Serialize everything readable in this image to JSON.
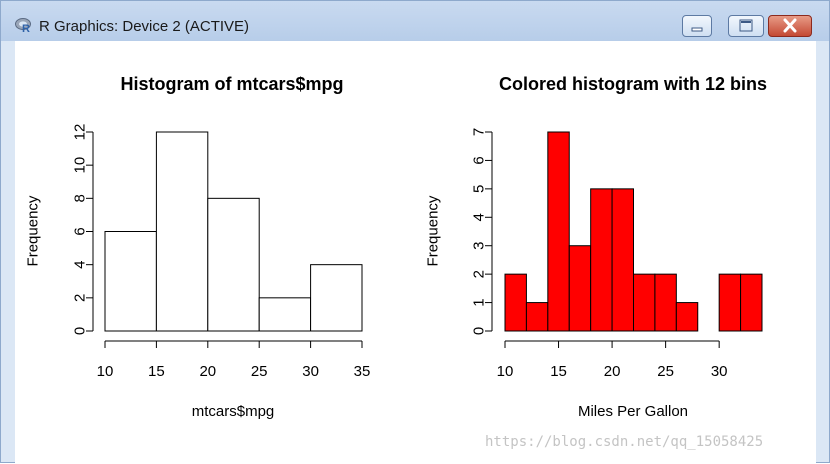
{
  "window": {
    "title": "R Graphics: Device 2 (ACTIVE)",
    "app_icon": "r-logo-icon",
    "controls": [
      "minimize-icon",
      "maximize-icon",
      "close-icon"
    ],
    "accent_color": "#c44a34"
  },
  "chart_data": [
    {
      "type": "bar",
      "title": "Histogram of mtcars$mpg",
      "xlabel": "mtcars$mpg",
      "ylabel": "Frequency",
      "bin_edges": [
        10,
        15,
        20,
        25,
        30,
        35
      ],
      "values": [
        6,
        12,
        8,
        2,
        4
      ],
      "xticks": [
        10,
        15,
        20,
        25,
        30,
        35
      ],
      "yticks": [
        0,
        2,
        4,
        6,
        8,
        10,
        12
      ],
      "xlim": [
        10,
        35
      ],
      "ylim": [
        0,
        12
      ],
      "fill": "#ffffff",
      "grid": false
    },
    {
      "type": "bar",
      "title": "Colored histogram with 12 bins",
      "xlabel": "Miles Per Gallon",
      "ylabel": "Frequency",
      "bin_edges": [
        10,
        12,
        14,
        16,
        18,
        20,
        22,
        24,
        26,
        28,
        30,
        32,
        34
      ],
      "values": [
        2,
        1,
        7,
        3,
        5,
        5,
        2,
        2,
        1,
        0,
        2,
        2
      ],
      "xticks": [
        10,
        15,
        20,
        25,
        30
      ],
      "yticks": [
        0,
        1,
        2,
        3,
        4,
        5,
        6,
        7
      ],
      "xlim": [
        10,
        34
      ],
      "ylim": [
        0,
        7
      ],
      "fill": "#ff0000",
      "grid": false
    }
  ],
  "watermark": "https://blog.csdn.net/qq_15058425"
}
